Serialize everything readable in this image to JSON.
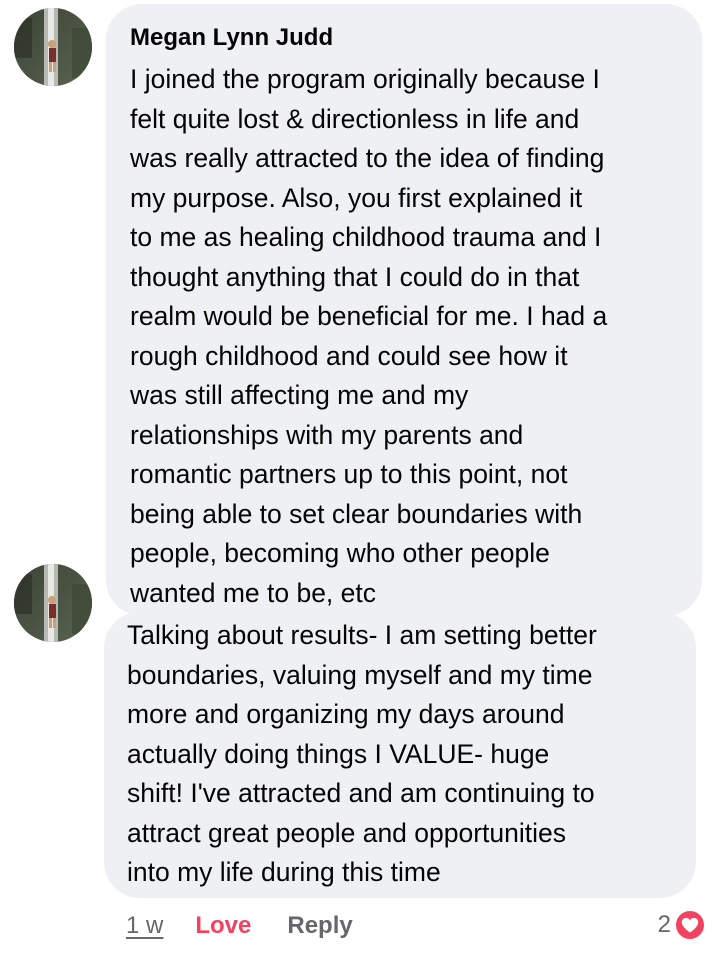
{
  "comments": [
    {
      "author": "Megan Lynn Judd",
      "text": "I joined the program originally because I\nfelt quite lost & directionless in life and\nwas really attracted to the idea of finding\nmy purpose. Also, you first explained it\nto me as healing childhood trauma and I\nthought anything that I could do in that\nrealm would be beneficial for me. I had a\nrough childhood and could see how it\nwas still affecting me and my\nrelationships with my parents and\nromantic partners up to this point, not\nbeing able to set clear boundaries with\npeople, becoming who other people\nwanted me to be, etc"
    },
    {
      "text": "Talking about results- I am setting better\nboundaries, valuing myself and my time\nmore and organizing my days around\nactually doing things I VALUE- huge\nshift! I've attracted and am continuing to\nattract great people and opportunities\ninto my life during this time"
    }
  ],
  "actions": {
    "timestamp": "1 w",
    "love_label": "Love",
    "reply_label": "Reply",
    "reaction_count": "2"
  },
  "icons": {
    "reaction": "heart-icon",
    "avatar": "profile-photo"
  },
  "colors": {
    "bubble": "#eff0f4",
    "love": "#f3425f",
    "secondary_text": "#65676b"
  }
}
